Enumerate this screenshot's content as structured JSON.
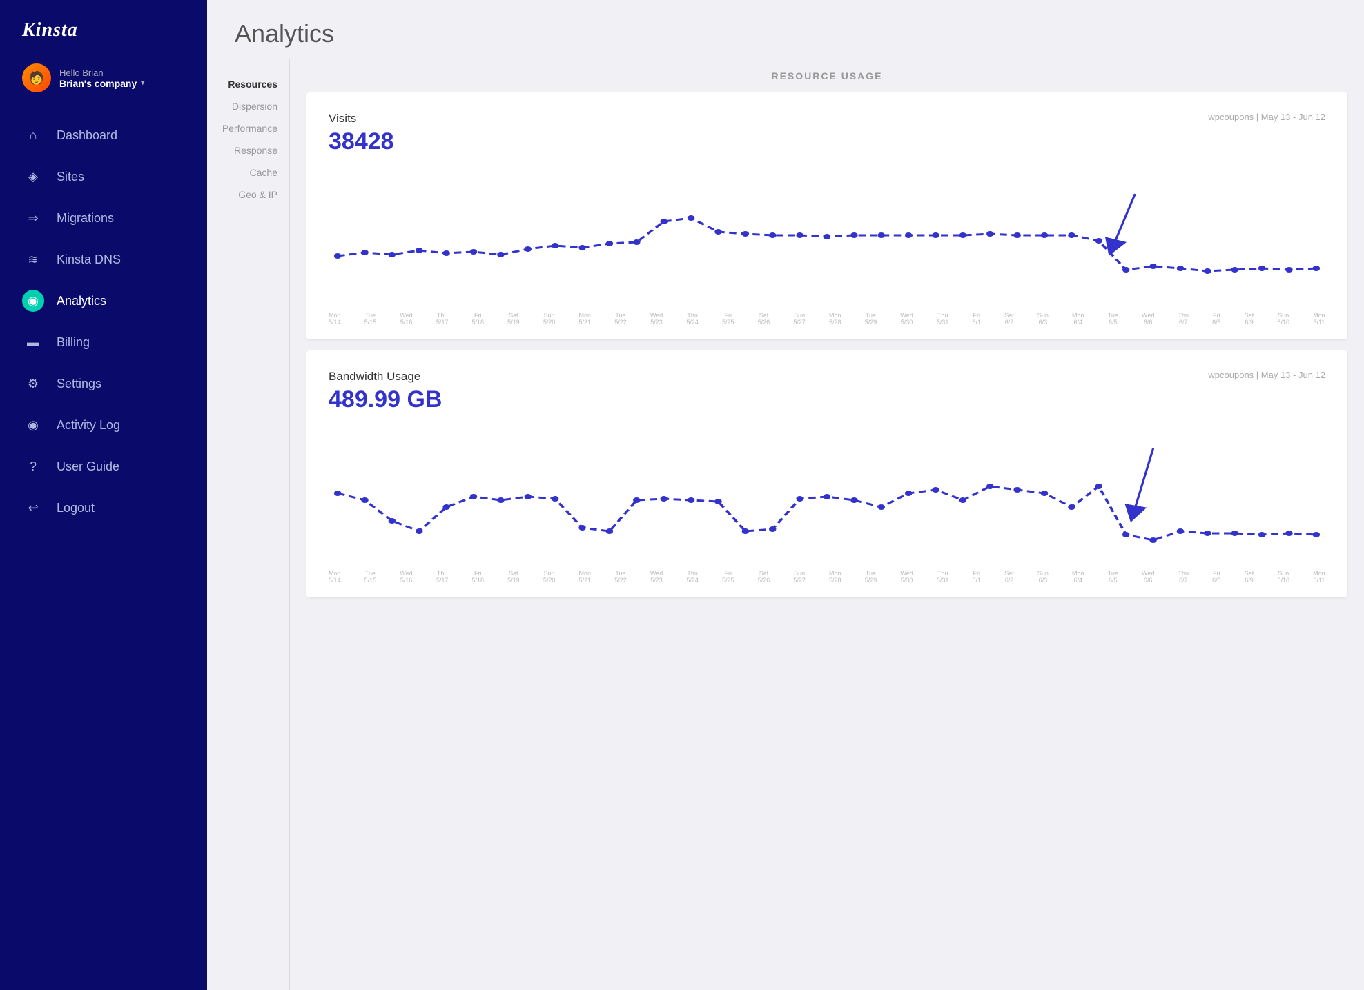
{
  "logo": "Kinsta",
  "user": {
    "greeting": "Hello Brian",
    "company": "Brian's company",
    "avatar_emoji": "👤"
  },
  "nav": {
    "items": [
      {
        "id": "dashboard",
        "label": "Dashboard",
        "icon": "⌂"
      },
      {
        "id": "sites",
        "label": "Sites",
        "icon": "◈"
      },
      {
        "id": "migrations",
        "label": "Migrations",
        "icon": "→"
      },
      {
        "id": "kinsta-dns",
        "label": "Kinsta DNS",
        "icon": "≋"
      },
      {
        "id": "analytics",
        "label": "Analytics",
        "icon": "◎",
        "active": true
      },
      {
        "id": "billing",
        "label": "Billing",
        "icon": "▭"
      },
      {
        "id": "settings",
        "label": "Settings",
        "icon": "⚙"
      },
      {
        "id": "activity-log",
        "label": "Activity Log",
        "icon": "👁"
      },
      {
        "id": "user-guide",
        "label": "User Guide",
        "icon": "?"
      },
      {
        "id": "logout",
        "label": "Logout",
        "icon": "↩"
      }
    ]
  },
  "sub_nav": {
    "items": [
      {
        "id": "resources",
        "label": "Resources",
        "active": true
      },
      {
        "id": "dispersion",
        "label": "Dispersion"
      },
      {
        "id": "performance",
        "label": "Performance"
      },
      {
        "id": "response",
        "label": "Response"
      },
      {
        "id": "cache",
        "label": "Cache"
      },
      {
        "id": "geo-ip",
        "label": "Geo & IP"
      }
    ]
  },
  "page_title": "Analytics",
  "resource_usage_header": "RESOURCE USAGE",
  "charts": [
    {
      "id": "visits",
      "label": "Visits",
      "value": "38428",
      "site": "wpcoupons",
      "date_range": "May 13 - Jun 12"
    },
    {
      "id": "bandwidth",
      "label": "Bandwidth Usage",
      "value": "489.99 GB",
      "site": "wpcoupons",
      "date_range": "May 13 - Jun 12"
    }
  ],
  "date_labels": [
    "Mon\n5/14",
    "Tue\n5/15",
    "Wed\n5/16",
    "Thu\n5/17",
    "Fri\n5/18",
    "Sat\n5/19",
    "Sun\n5/20",
    "Mon\n5/21",
    "Tue\n5/22",
    "Wed\n5/23",
    "Thu\n5/24",
    "Fri\n5/25",
    "Sat\n5/26",
    "Sun\n5/27",
    "Mon\n5/28",
    "Tue\n5/29",
    "Wed\n5/30",
    "Thu\n5/31",
    "Fri\n6/1",
    "Sat\n6/2",
    "Sun\n6/3",
    "Mon\n6/4",
    "Tue\n6/5",
    "Wed\n6/6",
    "Thu\n6/7",
    "Fri\n6/8",
    "Sat\n6/9",
    "Sun\n6/10",
    "Mon\n6/11"
  ]
}
